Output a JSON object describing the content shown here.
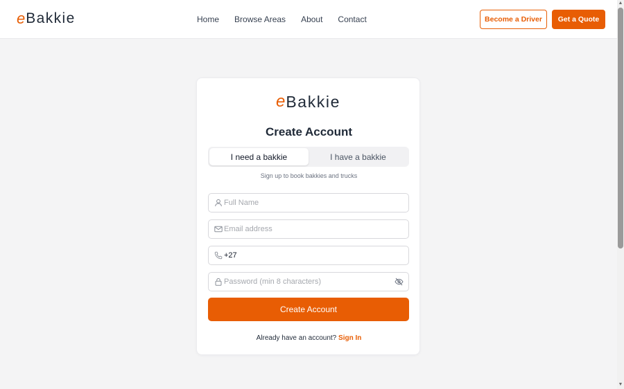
{
  "header": {
    "brand_mark": "e",
    "brand_name": "Bakkie",
    "nav": [
      "Home",
      "Browse Areas",
      "About",
      "Contact"
    ],
    "become_driver": "Become a Driver",
    "get_quote": "Get a Quote"
  },
  "card": {
    "brand_mark": "e",
    "brand_name": "Bakkie",
    "title": "Create Account",
    "toggle": {
      "active": "I need a bakkie",
      "inactive": "I have a bakkie"
    },
    "subtitle": "Sign up to book bakkies and trucks",
    "fields": {
      "full_name": {
        "placeholder": "Full Name",
        "value": ""
      },
      "email": {
        "placeholder": "Email address",
        "value": ""
      },
      "phone": {
        "placeholder": "",
        "value": "+27"
      },
      "password": {
        "placeholder": "Password (min 8 characters)",
        "value": ""
      }
    },
    "submit_label": "Create Account",
    "signin_prompt": "Already have an account?",
    "signin_link": "Sign In"
  },
  "colors": {
    "accent": "#e85d04",
    "background": "#f4f4f5",
    "card": "#ffffff"
  },
  "icons": {
    "full_name": "user-icon",
    "email": "mail-icon",
    "phone": "phone-icon",
    "password": "lock-icon",
    "password_toggle": "eye-off-icon"
  }
}
